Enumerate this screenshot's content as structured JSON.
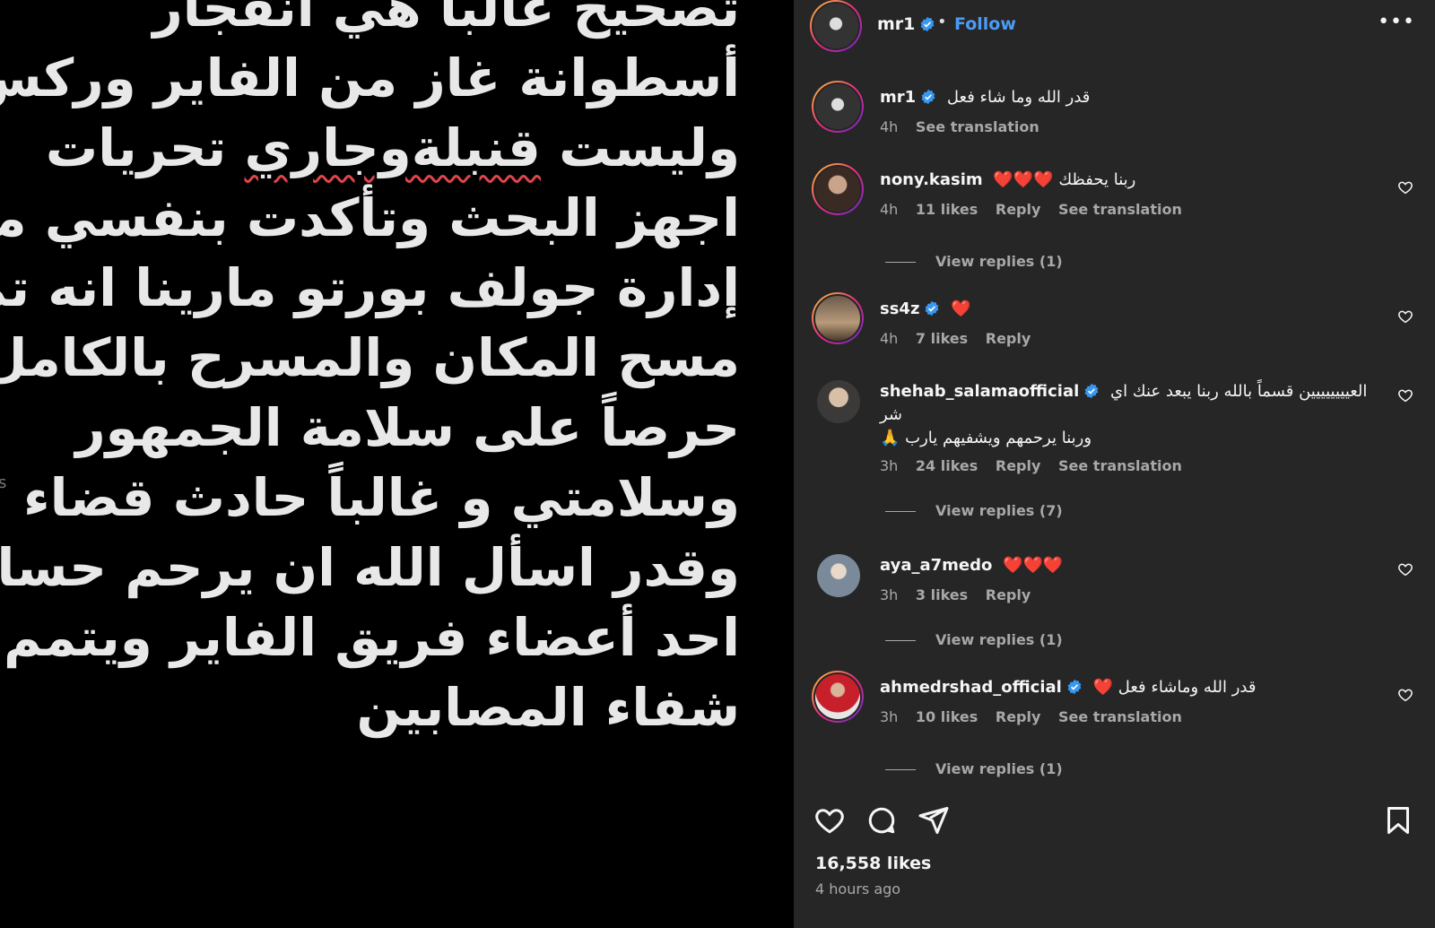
{
  "media": {
    "edge_char": "s",
    "lines": [
      "تصحيح غالباً هي انفجار",
      "أسطوانة غاز من الفاير وركس",
      "وليست ",
      "قنبلةوجاري",
      " تحريات",
      "اجهز البحث وتأكدت بنفسي من",
      "إدارة جولف بورتو مارينا انه تم",
      "مسح المكان والمسرح بالكامل",
      "حرصاً على سلامة الجمهور",
      "وسلامتي و غالباً حادث قضاء",
      "وقدر اسأل الله ان يرحم حسام",
      "احد أعضاء فريق الفاير ويتمم",
      "شفاء المصابين"
    ]
  },
  "header": {
    "username": "mr1",
    "separator": "•",
    "follow_label": "Follow",
    "more_label": "•••"
  },
  "comments": [
    {
      "username": "mr1",
      "text": "قدر الله وما شاء فعل",
      "time": "4h",
      "likes": "",
      "reply": "",
      "translate": "See translation",
      "view_replies": ""
    },
    {
      "username": "nony.kasim",
      "text": "ربنا يحفظك ❤️❤️❤️",
      "time": "4h",
      "likes": "11 likes",
      "reply": "Reply",
      "translate": "See translation",
      "view_replies": "View replies (1)"
    },
    {
      "username": "ss4z",
      "text": "❤️",
      "time": "4h",
      "likes": "7 likes",
      "reply": "Reply",
      "translate": "",
      "view_replies": ""
    },
    {
      "username": "shehab_salamaofficial",
      "text": "العيييييييين قسماً بالله ربنا يبعد عنك اي شر",
      "text2": "وربنا يرحمهم ويشفيهم يارب 🙏",
      "time": "3h",
      "likes": "24 likes",
      "reply": "Reply",
      "translate": "See translation",
      "view_replies": "View replies (7)"
    },
    {
      "username": "aya_a7medo",
      "text": "❤️❤️❤️",
      "time": "3h",
      "likes": "3 likes",
      "reply": "Reply",
      "translate": "",
      "view_replies": "View replies (1)"
    },
    {
      "username": "ahmedrshad_official",
      "text": "قدر الله وماشاء فعل ❤️",
      "time": "3h",
      "likes": "10 likes",
      "reply": "Reply",
      "translate": "See translation",
      "view_replies": "View replies (1)"
    }
  ],
  "footer": {
    "likes": "16,558 likes",
    "time_ago": "4 hours ago"
  },
  "colors": {
    "panel_bg": "#262626",
    "follow_blue": "#4a9cf5",
    "verified_blue": "#3897f0",
    "muted": "#a8a8a8"
  }
}
